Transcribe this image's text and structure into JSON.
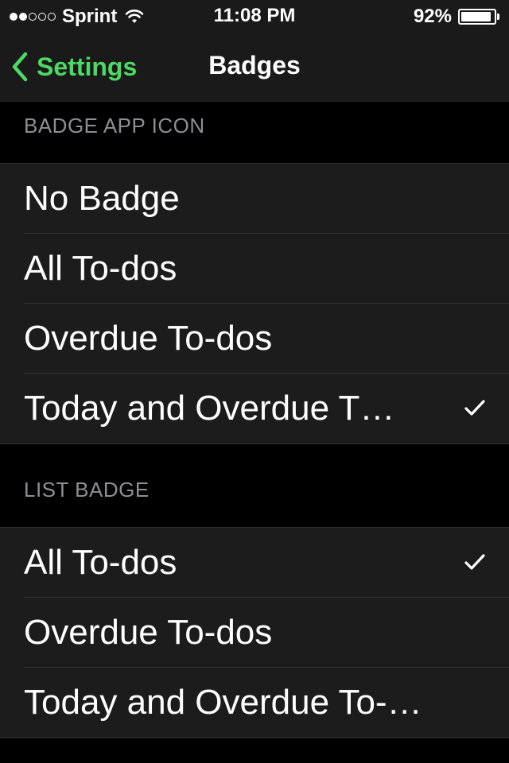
{
  "status_bar": {
    "carrier": "Sprint",
    "signal_bars_filled": 2,
    "signal_bars_total": 5,
    "time": "11:08 PM",
    "battery_percent": "92%",
    "battery_level": 0.92
  },
  "nav": {
    "back_label": "Settings",
    "title": "Badges",
    "accent_color": "#4cd964"
  },
  "sections": [
    {
      "header": "BADGE APP ICON",
      "items": [
        {
          "label": "No Badge",
          "checked": false
        },
        {
          "label": "All To-dos",
          "checked": false
        },
        {
          "label": "Overdue To-dos",
          "checked": false
        },
        {
          "label": "Today and Overdue T…",
          "checked": true
        }
      ]
    },
    {
      "header": "LIST BADGE",
      "items": [
        {
          "label": "All To-dos",
          "checked": true
        },
        {
          "label": "Overdue To-dos",
          "checked": false
        },
        {
          "label": "Today and Overdue To-…",
          "checked": false
        }
      ]
    }
  ],
  "icons": {
    "back": "chevron-left-icon",
    "wifi": "wifi-icon",
    "battery": "battery-icon",
    "check": "checkmark-icon"
  }
}
